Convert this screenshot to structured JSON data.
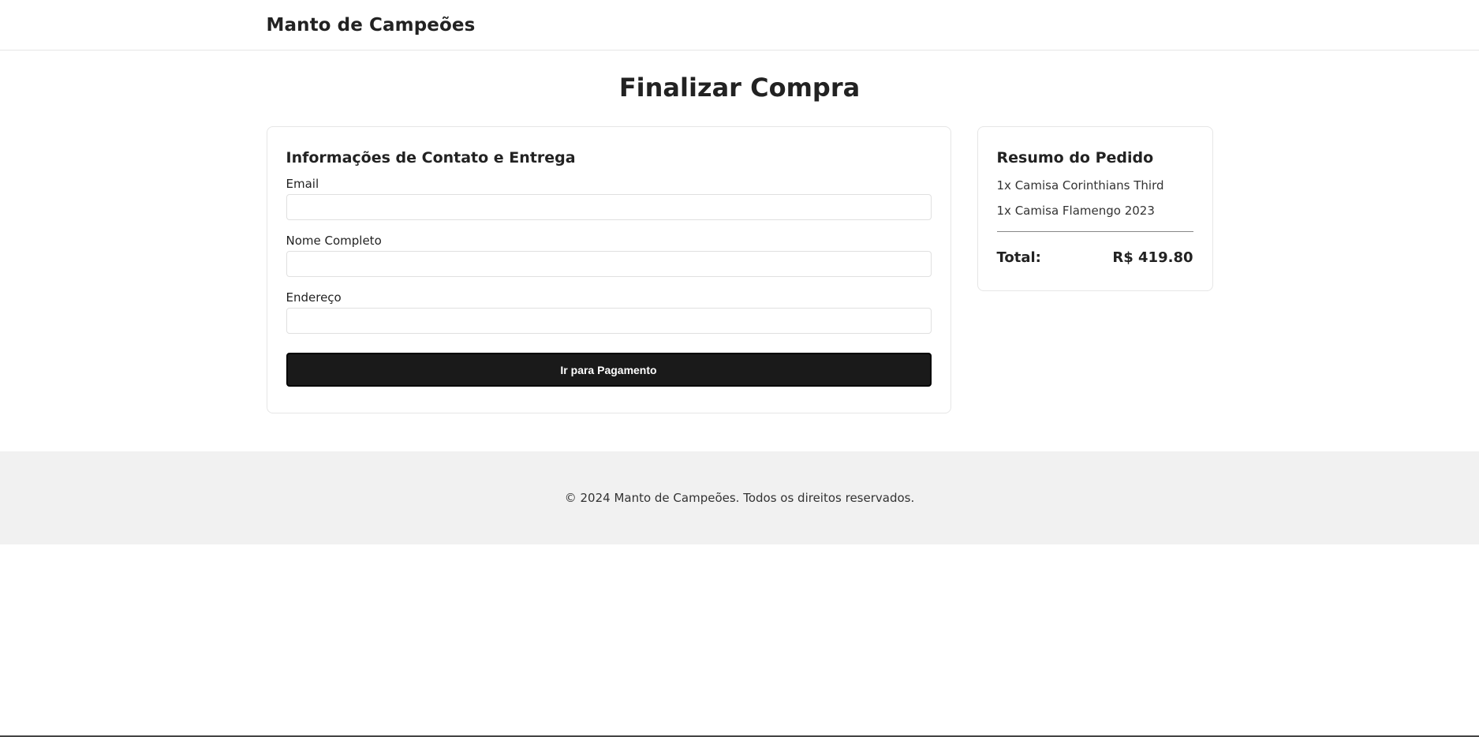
{
  "header": {
    "brand": "Manto de Campeões"
  },
  "main": {
    "title": "Finalizar Compra",
    "form": {
      "title": "Informações de Contato e Entrega",
      "fields": [
        {
          "label": "Email",
          "value": "",
          "placeholder": ""
        },
        {
          "label": "Nome Completo",
          "value": "",
          "placeholder": ""
        },
        {
          "label": "Endereço",
          "value": "",
          "placeholder": ""
        }
      ],
      "submit_label": "Ir para Pagamento"
    },
    "summary": {
      "title": "Resumo do Pedido",
      "items": [
        "1x Camisa Corinthians Third",
        "1x Camisa Flamengo 2023"
      ],
      "total_label": "Total:",
      "total_value": "R$ 419.80"
    }
  },
  "footer": {
    "text": "© 2024 Manto de Campeões. Todos os direitos reservados."
  },
  "colors": {
    "button_bg": "#1a1a1a",
    "footer_bg": "#f1f1f1",
    "border": "#e6e6e6",
    "text": "#222222"
  }
}
